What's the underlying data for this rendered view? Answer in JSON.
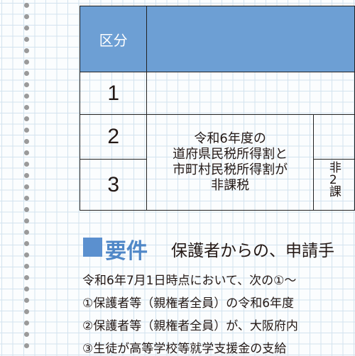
{
  "table": {
    "header": {
      "kubun": "区分"
    },
    "rows": [
      {
        "num": "1"
      },
      {
        "num": "2"
      },
      {
        "num": "3"
      }
    ],
    "condition_2_3": [
      "令和6年度の",
      "道府県民税所得割と",
      "市町村民税所得割が",
      "非課税"
    ],
    "truncated_right": [
      "非",
      "2",
      "課"
    ]
  },
  "section": {
    "title": "要件",
    "subtitle": "保護者からの、申請手"
  },
  "lines": [
    "令和6年7月1日時点において、次の①～",
    "①保護者等（親権者全員）の令和6年度",
    "②保護者等（親権者全員）が、大阪府内",
    "③生徒が高等学校等就学支援金の支給"
  ],
  "colors": {
    "header_bg": "#6d9fd4",
    "heading_accent": "#4f87c7",
    "grid_line": "#d3e3ef"
  }
}
